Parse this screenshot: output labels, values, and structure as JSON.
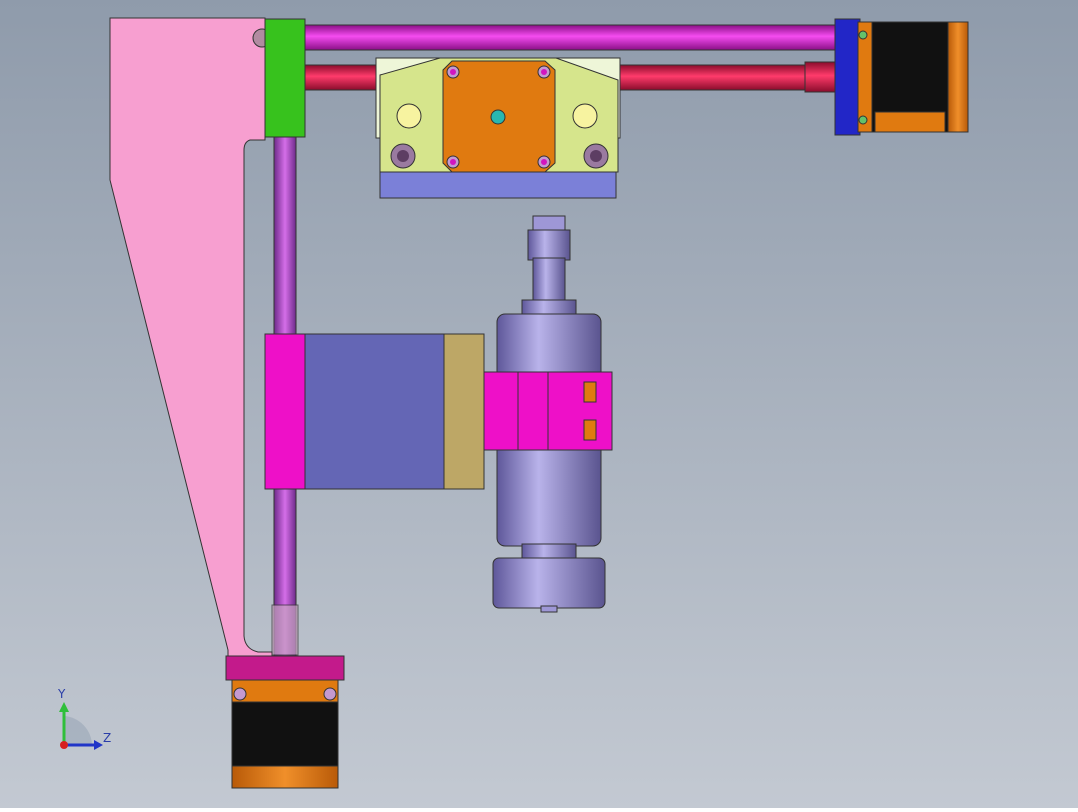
{
  "viewport": {
    "background_top": "#8f9bab",
    "background_bottom": "#c3c9d2"
  },
  "triad": {
    "x_label": "",
    "y_label": "Y",
    "z_label": "Z",
    "y_color": "#2fbf3a",
    "z_color": "#2035c8",
    "origin_color": "#d62020"
  },
  "parts": [
    {
      "name": "side-plate",
      "color": "#f79fd0"
    },
    {
      "name": "y-guide-rod",
      "color": "#c54bd6"
    },
    {
      "name": "x-guide-rod-upper",
      "color": "#e825d8"
    },
    {
      "name": "x-guide-rod-lower",
      "color": "#e8204f"
    },
    {
      "name": "green-end-block",
      "color": "#37c21d"
    },
    {
      "name": "blue-end-block",
      "color": "#2226c7"
    },
    {
      "name": "carriage-plate",
      "color": "#d6e58c"
    },
    {
      "name": "carriage-base",
      "color": "#7b80d8"
    },
    {
      "name": "stepper-motor-x-carriage",
      "color": "#e07a10"
    },
    {
      "name": "stepper-motor-right",
      "color": "#e07a10"
    },
    {
      "name": "stepper-motor-bottom",
      "color": "#e07a10"
    },
    {
      "name": "motor-mount-plate",
      "color": "#c31a8b"
    },
    {
      "name": "z-slider-block",
      "color": "#ee10c8"
    },
    {
      "name": "z-slider-body",
      "color": "#6466b5"
    },
    {
      "name": "z-slider-endcap",
      "color": "#bda766"
    },
    {
      "name": "spindle-motor",
      "color": "#8d86c8"
    },
    {
      "name": "spindle-clamp",
      "color": "#ee10c8"
    }
  ]
}
